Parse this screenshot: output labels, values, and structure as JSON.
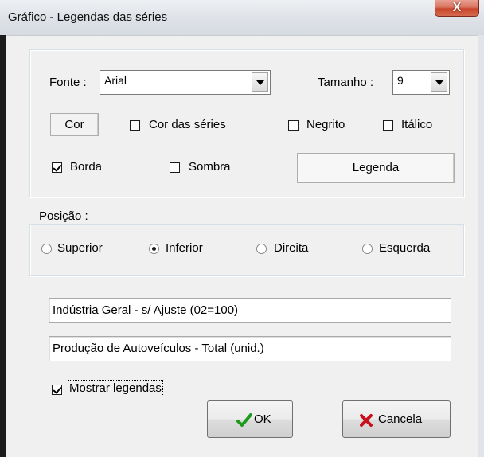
{
  "window": {
    "title": "Gráfico - Legendas das séries",
    "close_glyph": "X"
  },
  "font_group": {
    "font_label": "Fonte :",
    "font_value": "Arial",
    "size_label": "Tamanho :",
    "size_value": "9",
    "color_button": "Cor",
    "series_color_label": "Cor das séries",
    "series_color_checked": false,
    "bold_label": "Negrito",
    "bold_checked": false,
    "italic_label": "Itálico",
    "italic_checked": false,
    "border_label": "Borda",
    "border_checked": true,
    "shadow_label": "Sombra",
    "shadow_checked": false,
    "legend_button": "Legenda"
  },
  "position_group": {
    "title": "Posição :",
    "options": [
      {
        "label": "Superior",
        "selected": false
      },
      {
        "label": "Inferior",
        "selected": true
      },
      {
        "label": "Direita",
        "selected": false
      },
      {
        "label": "Esquerda",
        "selected": false
      }
    ]
  },
  "series": {
    "legend_1": "Indústria Geral - s/ Ajuste (02=100)",
    "legend_2": "Produção de Autoveículos - Total (unid.)"
  },
  "show_legends": {
    "label": "Mostrar legendas",
    "checked": true
  },
  "footer": {
    "ok_label": "OK",
    "ok_icon": "checkmark-icon",
    "cancel_label": "Cancela",
    "cancel_icon": "red-x-icon",
    "ok_icon_color": "#1d9b1d",
    "cancel_icon_color": "#c8101a"
  }
}
